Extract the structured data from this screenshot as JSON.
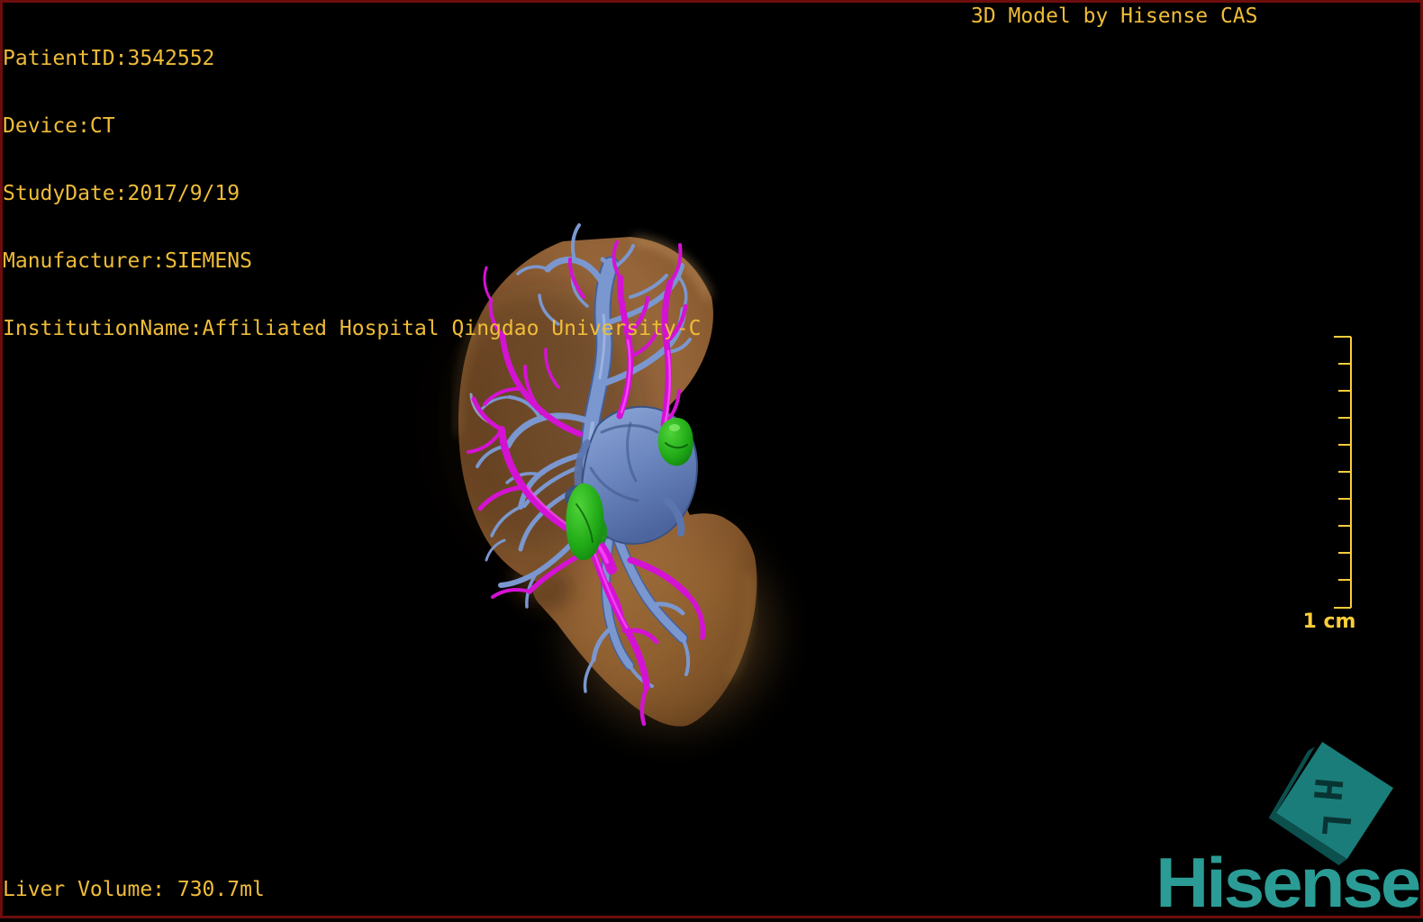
{
  "header": {
    "info_lines": [
      "PatientID:3542552",
      "Device:CT",
      "StudyDate:2017/9/19",
      "Manufacturer:SIEMENS",
      "InstitutionName:Affiliated Hospital Qingdao University-C"
    ],
    "title": "3D Model by Hisense CAS"
  },
  "viewport": {
    "scale_bar": {
      "label": "1 cm"
    },
    "orientation_cube": {
      "letters": [
        "H",
        "L"
      ]
    },
    "model": {
      "organ": "liver",
      "structure_colors": {
        "liver": "#96663a",
        "veins": "#7b97cf",
        "arteries": "#d412d4",
        "green_structure": "#1fa816"
      }
    }
  },
  "footer": {
    "liver_volume": "Liver Volume: 730.7ml"
  },
  "branding": {
    "wordmark": "Hisense",
    "color": "#2a9c95"
  },
  "theme": {
    "background": "#000000",
    "border_color": "#6e0d0d",
    "annotation_color": "#f0bc38",
    "scale_color": "#f9cd3a"
  }
}
